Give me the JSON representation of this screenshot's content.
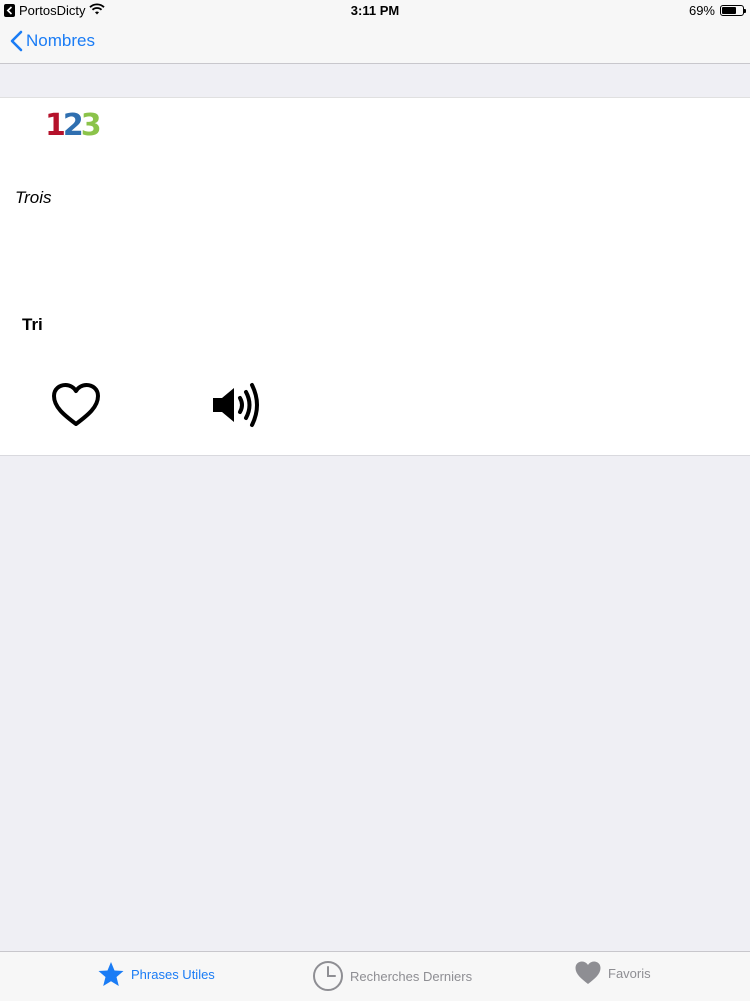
{
  "status_bar": {
    "carrier": "PortosDicty",
    "time": "3:11 PM",
    "battery_percent": "69%",
    "battery_level": 0.69
  },
  "nav": {
    "back_label": "Nombres"
  },
  "entry": {
    "logo_digits": [
      "1",
      "2",
      "3"
    ],
    "logo_colors": [
      "#b5122b",
      "#2f6fb0",
      "#8bc34a"
    ],
    "word": "Trois",
    "translation": "Tri"
  },
  "tabs": [
    {
      "label": "Phrases Utiles",
      "icon": "star-icon",
      "active": true
    },
    {
      "label": "Recherches Derniers",
      "icon": "clock-icon",
      "active": false
    },
    {
      "label": "Favoris",
      "icon": "heart-icon",
      "active": false
    }
  ],
  "colors": {
    "accent": "#1a7cf5",
    "inactive": "#8e8e93",
    "background": "#efeff4"
  }
}
